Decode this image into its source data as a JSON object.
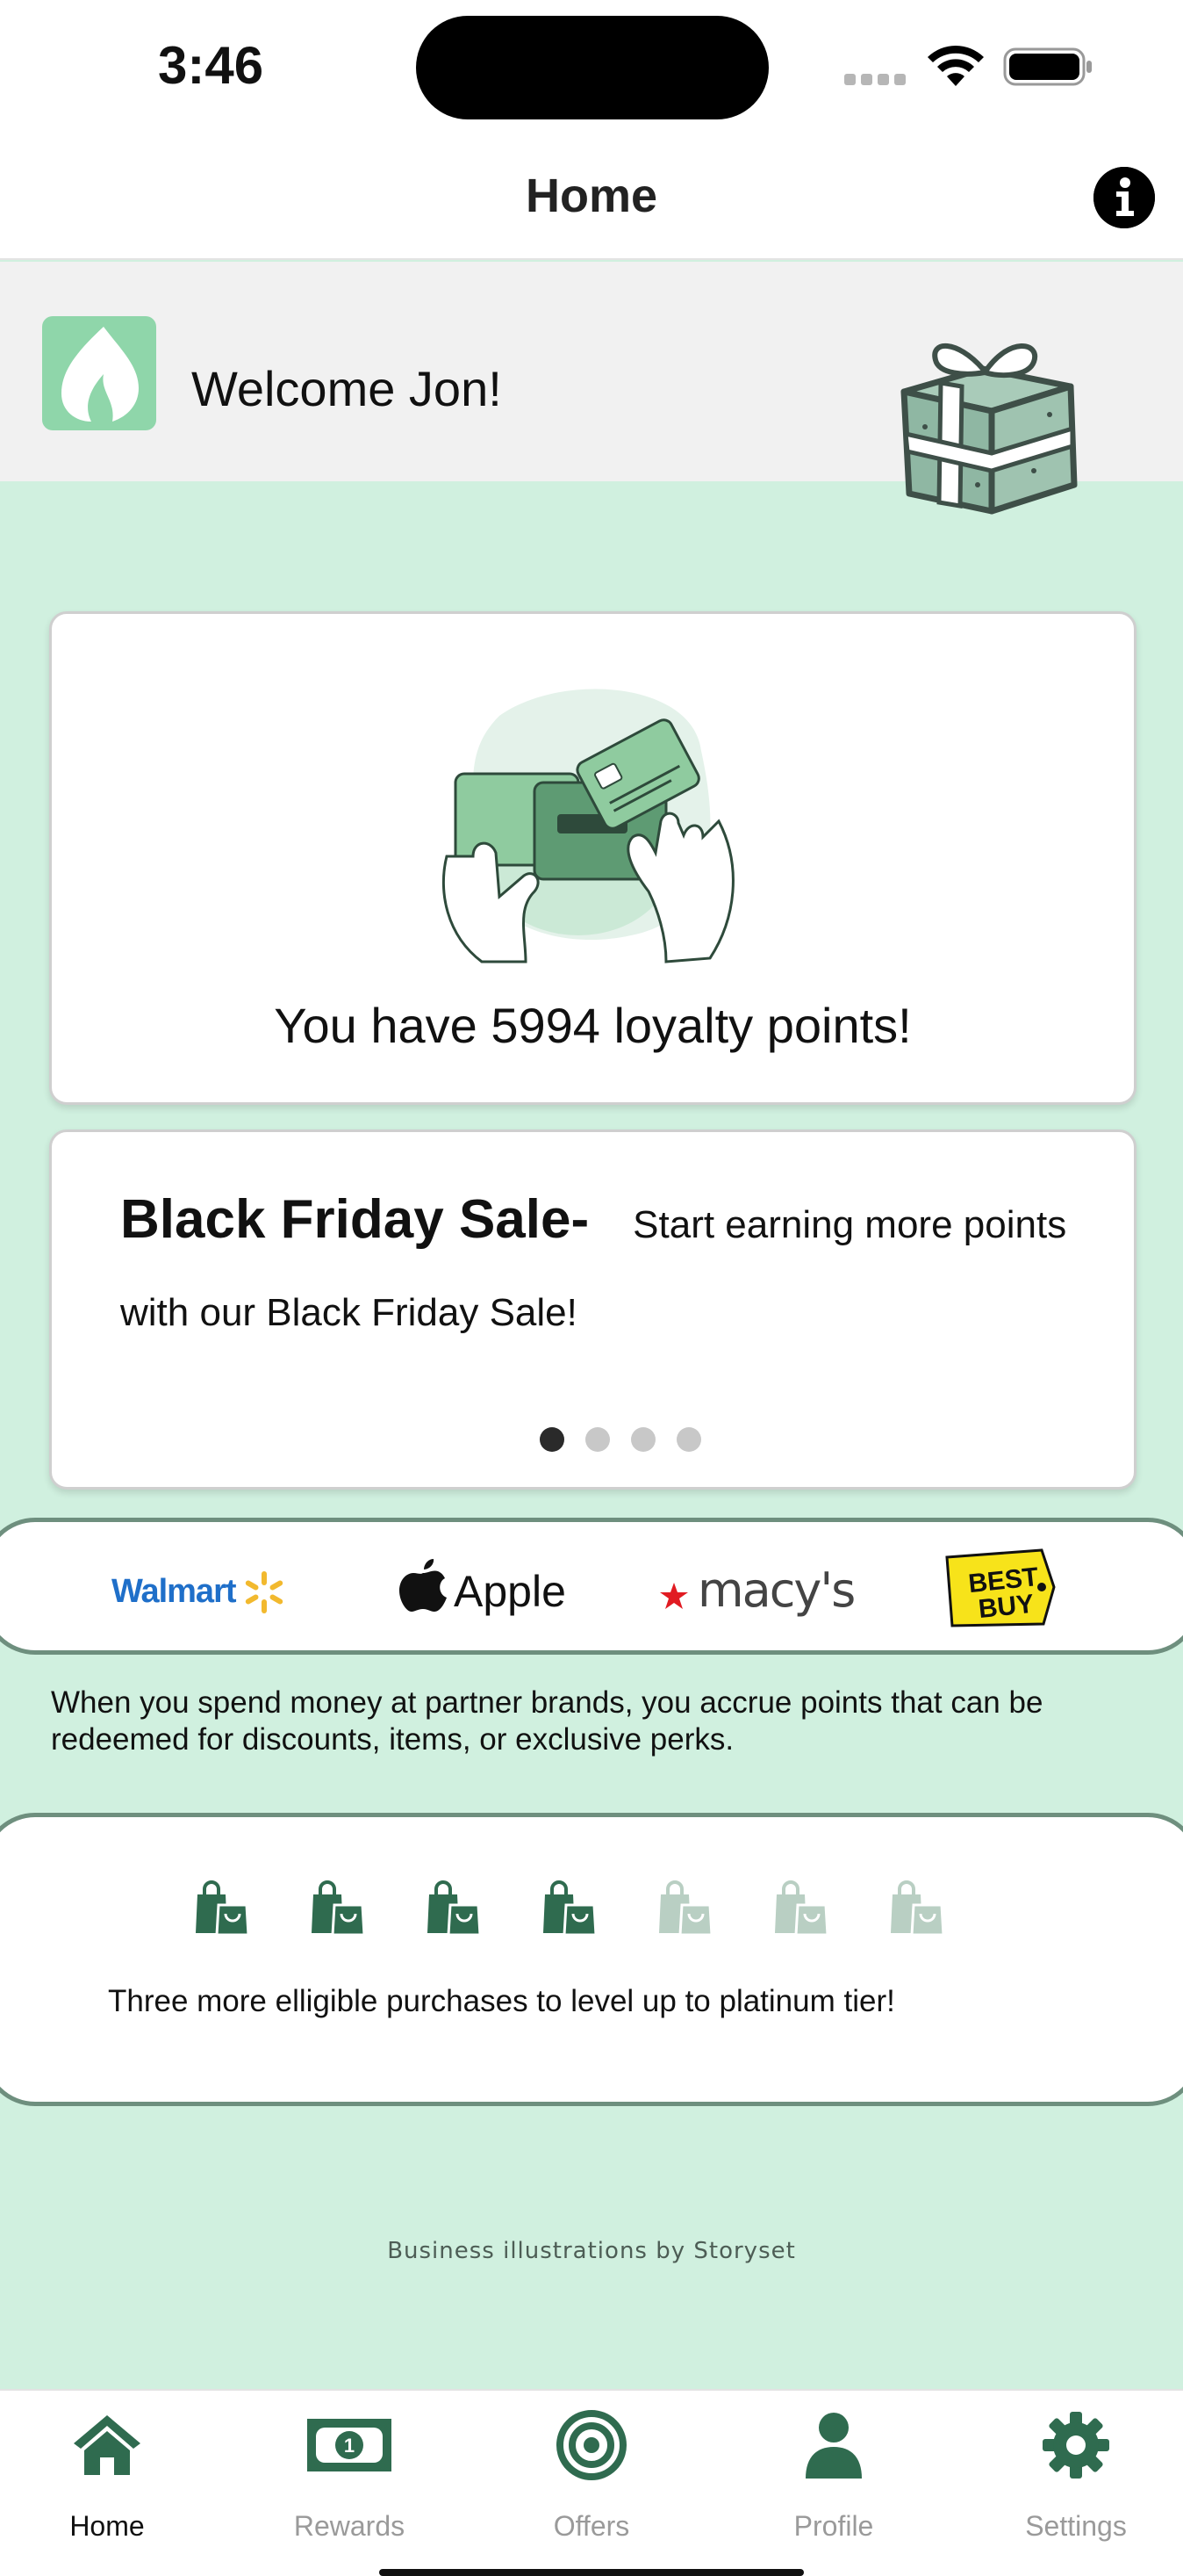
{
  "status_bar": {
    "time": "3:46"
  },
  "header": {
    "title": "Home"
  },
  "welcome": {
    "text": "Welcome Jon!"
  },
  "points": {
    "text": "You have 5994 loyalty points!"
  },
  "promo": {
    "title": "Black Friday Sale-",
    "body": "Start earning more points with our Black Friday Sale!",
    "page_count": 4,
    "active_page": 1
  },
  "brands": {
    "walmart": "Walmart",
    "apple": "Apple",
    "macys": "macy's",
    "bestbuy": "BEST BUY"
  },
  "info": {
    "text": "When you spend money at partner brands, you accrue points that can be redeemed for discounts, items, or exclusive perks."
  },
  "progress": {
    "completed": 4,
    "total": 7,
    "text": "Three more elligible purchases to level up to platinum tier!"
  },
  "footer": {
    "credit": "Business illustrations by Storyset"
  },
  "tabs": [
    {
      "label": "Home",
      "icon": "house-icon",
      "active": true
    },
    {
      "label": "Rewards",
      "icon": "banknote-icon",
      "active": false
    },
    {
      "label": "Offers",
      "icon": "target-icon",
      "active": false
    },
    {
      "label": "Profile",
      "icon": "person-icon",
      "active": false
    },
    {
      "label": "Settings",
      "icon": "gear-icon",
      "active": false
    }
  ],
  "colors": {
    "accent": "#2f6b4f",
    "background": "#d0f0df",
    "inactive_bag": "#b9cfc3",
    "tab_active": "#2f6b4f"
  }
}
